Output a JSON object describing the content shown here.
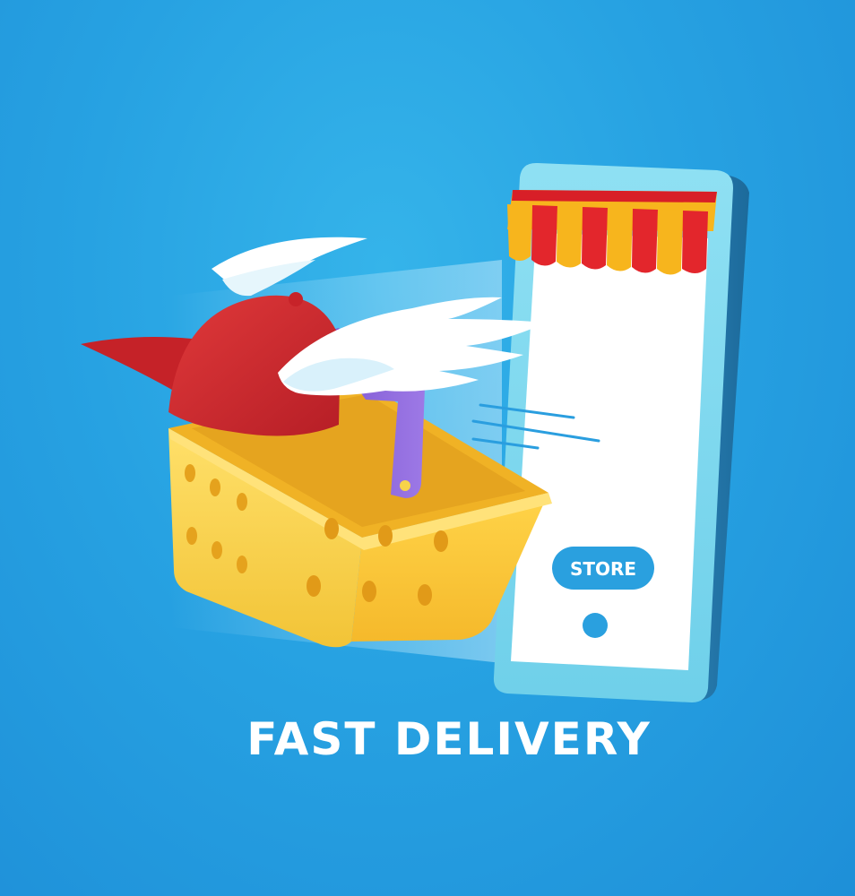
{
  "phone": {
    "store_button_label": "STORE"
  },
  "headline": "FAST DELIVERY",
  "colors": {
    "background": "#27a2e2",
    "phone_body": "#7fd8ef",
    "phone_screen": "#ffffff",
    "store_button": "#2aa0df",
    "awning_red": "#e3262c",
    "awning_yellow": "#f7b51d",
    "basket": "#f9c93c",
    "cap": "#d62c2c",
    "handle": "#8b5cd6",
    "wings": "#ffffff"
  },
  "icons": [
    "winged-cap-icon",
    "shopping-basket-icon",
    "smartphone-icon",
    "store-awning-icon",
    "speed-lines-icon"
  ]
}
